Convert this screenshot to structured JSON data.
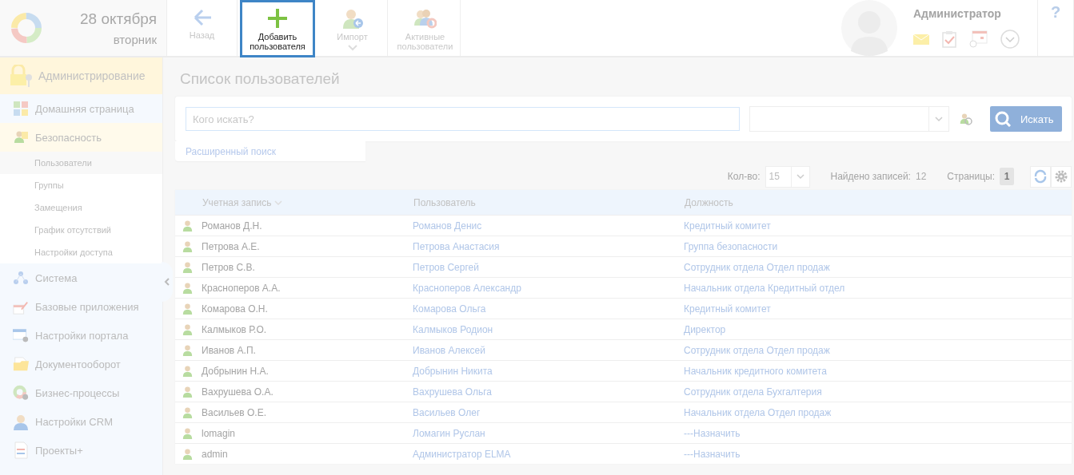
{
  "header": {
    "date": "28 октября",
    "weekday": "вторник",
    "toolbar": [
      {
        "kind": "back",
        "label": "Назад",
        "highlighted": false
      },
      {
        "kind": "add",
        "label": "Добавить пользователя",
        "highlighted": true
      },
      {
        "kind": "import",
        "label": "Импорт",
        "highlighted": false
      },
      {
        "kind": "active",
        "label": "Активные пользователи",
        "highlighted": false
      }
    ],
    "user": {
      "name": "Администратор"
    },
    "help": "?"
  },
  "sidebar": {
    "title": "Администрирование",
    "items": [
      {
        "label": "Домашняя страница",
        "expanded": false
      },
      {
        "label": "Безопасность",
        "expanded": true,
        "children": [
          {
            "label": "Пользователи",
            "selected": true
          },
          {
            "label": "Группы",
            "selected": false
          },
          {
            "label": "Замещения",
            "selected": false
          },
          {
            "label": "График отсутствий",
            "selected": false
          },
          {
            "label": "Настройки доступа",
            "selected": false
          }
        ]
      },
      {
        "label": "Система",
        "expanded": false
      },
      {
        "label": "Базовые приложения",
        "expanded": false
      },
      {
        "label": "Настройки портала",
        "expanded": false
      },
      {
        "label": "Документооборот",
        "expanded": false
      },
      {
        "label": "Бизнес-процессы",
        "expanded": false
      },
      {
        "label": "Настройки CRM",
        "expanded": false
      },
      {
        "label": "Проекты+",
        "expanded": false
      }
    ]
  },
  "page_title": "Список пользователей",
  "search": {
    "placeholder": "Кого искать?",
    "button": "Искать",
    "advanced_link": "Расширенный поиск"
  },
  "pager": {
    "count_label": "Кол-во:",
    "count": "15",
    "found_label": "Найдено записей:",
    "found": "12",
    "pages_label": "Страницы:",
    "page": "1"
  },
  "table": {
    "columns": [
      "Учетная запись",
      "Пользователь",
      "Должность"
    ],
    "rows": [
      [
        "Романов Д.Н.",
        "Романов Денис",
        "Кредитный комитет"
      ],
      [
        "Петрова А.Е.",
        "Петрова Анастасия",
        "Группа безопасности"
      ],
      [
        "Петров С.В.",
        "Петров Сергей",
        "Сотрудник отдела Отдел продаж"
      ],
      [
        "Красноперов А.А.",
        "Красноперов Александр",
        "Начальник отдела Кредитный отдел"
      ],
      [
        "Комарова О.Н.",
        "Комарова Ольга",
        "Кредитный комитет"
      ],
      [
        "Калмыков Р.О.",
        "Калмыков Родион",
        "Директор"
      ],
      [
        "Иванов А.П.",
        "Иванов Алексей",
        "Сотрудник отдела Отдел продаж"
      ],
      [
        "Добрынин Н.А.",
        "Добрынин Никита",
        "Начальник кредитного комитета"
      ],
      [
        "Вахрушева О.А.",
        "Вахрушева Ольга",
        "Сотрудник отдела Бухгалтерия"
      ],
      [
        "Васильев О.Е.",
        "Васильев Олег",
        "Начальник отдела Отдел продаж"
      ],
      [
        "lomagin",
        "Ломагин Руслан",
        "---Назначить"
      ],
      [
        "admin",
        "Администратор ELMA",
        "---Назначить"
      ]
    ]
  }
}
